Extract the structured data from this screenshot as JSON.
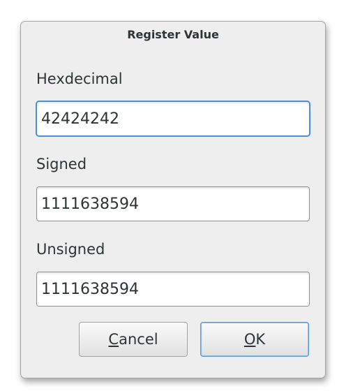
{
  "dialog": {
    "title": "Register Value",
    "hex": {
      "label": "Hexdecimal",
      "value": "42424242"
    },
    "signed": {
      "label": "Signed",
      "value": "1111638594"
    },
    "unsigned": {
      "label": "Unsigned",
      "value": "1111638594"
    },
    "buttons": {
      "cancel": {
        "mnemonic": "C",
        "rest": "ancel"
      },
      "ok": {
        "mnemonic": "O",
        "rest": "K"
      }
    }
  },
  "colors": {
    "dialog_bg": "#eeeeee",
    "focus_border": "#4a90d9",
    "text": "#2e3436"
  }
}
